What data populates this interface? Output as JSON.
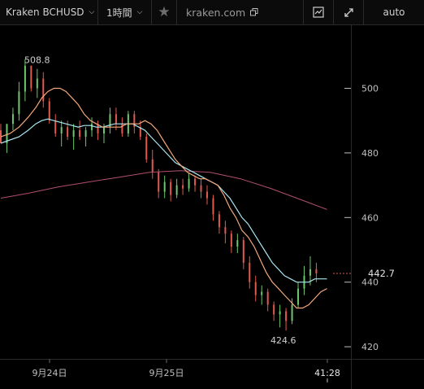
{
  "toolbar": {
    "symbol": "Kraken BCHUSD",
    "interval": "1時間",
    "domain": "kraken.com",
    "scale_mode": "auto",
    "icons": [
      "chevron-down-icon",
      "star-icon",
      "copy-icon",
      "chart-style-icon",
      "fullscreen-icon"
    ]
  },
  "chart_data": {
    "type": "candlestick",
    "y_ticks": [
      "500",
      "480",
      "460",
      "440",
      "420"
    ],
    "x_ticks": [
      "9月24日",
      "9月25日",
      "41:28"
    ],
    "last_price": "442.7",
    "high_label": "508.8",
    "low_label": "424.6",
    "ylim": [
      417,
      516
    ],
    "colors": {
      "up": "#6ec66e",
      "down": "#e05a4f",
      "ma_fast": "#f3a77a",
      "ma_mid": "#a8e6f0",
      "ma_slow": "#b0506a"
    },
    "candles": [
      [
        487.0,
        489.0,
        484.0,
        483.0
      ],
      [
        483.0,
        488.0,
        480.0,
        489.0
      ],
      [
        489.0,
        494.0,
        487.0,
        492.0
      ],
      [
        492.0,
        502.0,
        490.0,
        499.0
      ],
      [
        499.0,
        509.0,
        496.0,
        507.0
      ],
      [
        507.0,
        507.0,
        499.0,
        500.0
      ],
      [
        500.0,
        506.0,
        497.0,
        503.0
      ],
      [
        503.0,
        505.0,
        494.0,
        496.0
      ],
      [
        496.0,
        497.0,
        489.0,
        490.0
      ],
      [
        490.0,
        492.0,
        485.0,
        486.0
      ],
      [
        486.0,
        490.0,
        482.0,
        488.0
      ],
      [
        488.0,
        490.0,
        484.0,
        485.0
      ],
      [
        485.0,
        489.0,
        481.0,
        487.0
      ],
      [
        487.0,
        490.0,
        484.0,
        485.0
      ],
      [
        485.0,
        488.0,
        482.0,
        487.0
      ],
      [
        487.0,
        491.0,
        485.0,
        489.0
      ],
      [
        489.0,
        490.0,
        484.0,
        486.0
      ],
      [
        486.0,
        489.0,
        483.0,
        488.0
      ],
      [
        488.0,
        494.0,
        486.0,
        492.0
      ],
      [
        492.0,
        494.0,
        487.0,
        489.0
      ],
      [
        489.0,
        491.0,
        485.0,
        486.0
      ],
      [
        486.0,
        493.0,
        485.0,
        492.0
      ],
      [
        492.0,
        493.0,
        486.0,
        488.0
      ],
      [
        488.0,
        490.0,
        484.0,
        485.0
      ],
      [
        485.0,
        486.0,
        477.0,
        478.0
      ],
      [
        478.0,
        481.0,
        472.0,
        474.0
      ],
      [
        474.0,
        475.0,
        466.0,
        468.0
      ],
      [
        468.0,
        473.0,
        466.0,
        471.0
      ],
      [
        471.0,
        472.0,
        465.0,
        467.0
      ],
      [
        467.0,
        472.0,
        466.0,
        470.0
      ],
      [
        470.0,
        472.0,
        467.0,
        469.0
      ],
      [
        469.0,
        474.0,
        468.0,
        472.0
      ],
      [
        472.0,
        473.0,
        468.0,
        470.0
      ],
      [
        470.0,
        472.0,
        466.0,
        468.0
      ],
      [
        468.0,
        470.0,
        464.0,
        466.0
      ],
      [
        466.0,
        467.0,
        459.0,
        461.0
      ],
      [
        461.0,
        462.0,
        455.0,
        457.0
      ],
      [
        457.0,
        459.0,
        452.0,
        455.0
      ],
      [
        455.0,
        456.0,
        449.0,
        451.0
      ],
      [
        451.0,
        455.0,
        449.0,
        453.0
      ],
      [
        453.0,
        454.0,
        444.0,
        446.0
      ],
      [
        446.0,
        448.0,
        438.0,
        440.0
      ],
      [
        440.0,
        442.0,
        434.0,
        436.0
      ],
      [
        436.0,
        439.0,
        433.0,
        437.0
      ],
      [
        437.0,
        438.0,
        431.0,
        433.0
      ],
      [
        433.0,
        434.0,
        428.0,
        430.0
      ],
      [
        430.0,
        433.0,
        426.0,
        431.0
      ],
      [
        431.0,
        432.0,
        425.0,
        428.0
      ],
      [
        428.0,
        435.0,
        427.0,
        433.0
      ],
      [
        433.0,
        440.0,
        432.0,
        438.0
      ],
      [
        438.0,
        445.0,
        436.0,
        442.0
      ],
      [
        442.0,
        448.0,
        439.0,
        444.0
      ],
      [
        444.0,
        446.0,
        440.0,
        442.7
      ]
    ],
    "ma_fast": [
      [
        482,
        485
      ],
      [
        488,
        486
      ],
      [
        494,
        488
      ],
      [
        500,
        491
      ],
      [
        505,
        494
      ],
      [
        509,
        497
      ],
      [
        513,
        499
      ],
      [
        517,
        500
      ],
      [
        521,
        500
      ],
      [
        525,
        499
      ],
      [
        529,
        497
      ],
      [
        533,
        495
      ],
      [
        537,
        492
      ],
      [
        541,
        490
      ],
      [
        545,
        489
      ],
      [
        549,
        488
      ],
      [
        553,
        488
      ],
      [
        557,
        488
      ],
      [
        561,
        488
      ],
      [
        565,
        489
      ],
      [
        569,
        489
      ],
      [
        573,
        489
      ],
      [
        577,
        490
      ],
      [
        581,
        489
      ],
      [
        585,
        487
      ],
      [
        589,
        484
      ],
      [
        593,
        481
      ],
      [
        597,
        478
      ],
      [
        601,
        476
      ],
      [
        605,
        474
      ],
      [
        609,
        473
      ],
      [
        613,
        472
      ],
      [
        617,
        472
      ],
      [
        621,
        471
      ],
      [
        625,
        470
      ],
      [
        629,
        467
      ],
      [
        633,
        463
      ],
      [
        637,
        460
      ],
      [
        641,
        456
      ],
      [
        645,
        454
      ],
      [
        649,
        451
      ],
      [
        653,
        447
      ],
      [
        657,
        443
      ],
      [
        661,
        440
      ],
      [
        665,
        438
      ],
      [
        669,
        436
      ],
      [
        673,
        434
      ],
      [
        677,
        432
      ],
      [
        681,
        432
      ],
      [
        685,
        433
      ],
      [
        689,
        435
      ],
      [
        693,
        437
      ],
      [
        697,
        438
      ]
    ],
    "ma_mid": [
      [
        482,
        483
      ],
      [
        488,
        484
      ],
      [
        494,
        485
      ],
      [
        500,
        487
      ],
      [
        505,
        489
      ],
      [
        509,
        490
      ],
      [
        513,
        490.5
      ],
      [
        517,
        490
      ],
      [
        521,
        489.5
      ],
      [
        525,
        489
      ],
      [
        529,
        488.5
      ],
      [
        533,
        488
      ],
      [
        537,
        488.5
      ],
      [
        541,
        488.5
      ],
      [
        545,
        488
      ],
      [
        549,
        488
      ],
      [
        553,
        488.5
      ],
      [
        557,
        489
      ],
      [
        561,
        489
      ],
      [
        565,
        489
      ],
      [
        569,
        489
      ],
      [
        573,
        488
      ],
      [
        577,
        487
      ],
      [
        581,
        485
      ],
      [
        585,
        483
      ],
      [
        589,
        481
      ],
      [
        593,
        479
      ],
      [
        597,
        477
      ],
      [
        601,
        476
      ],
      [
        605,
        475
      ],
      [
        609,
        474
      ],
      [
        613,
        473
      ],
      [
        617,
        472
      ],
      [
        621,
        471
      ],
      [
        625,
        470
      ],
      [
        629,
        468
      ],
      [
        633,
        466
      ],
      [
        637,
        463
      ],
      [
        641,
        460
      ],
      [
        645,
        458
      ],
      [
        649,
        455
      ],
      [
        653,
        452
      ],
      [
        657,
        449
      ],
      [
        661,
        446
      ],
      [
        665,
        444
      ],
      [
        669,
        442
      ],
      [
        673,
        441
      ],
      [
        677,
        440
      ],
      [
        681,
        440
      ],
      [
        685,
        440
      ],
      [
        689,
        441
      ],
      [
        693,
        441
      ],
      [
        697,
        441
      ]
    ],
    "ma_slow": [
      [
        482,
        466
      ],
      [
        500,
        467.5
      ],
      [
        520,
        469.5
      ],
      [
        540,
        471
      ],
      [
        560,
        472.5
      ],
      [
        580,
        474
      ],
      [
        600,
        474.5
      ],
      [
        620,
        474
      ],
      [
        640,
        472
      ],
      [
        660,
        469
      ],
      [
        680,
        465.5
      ],
      [
        697,
        462.5
      ]
    ]
  }
}
